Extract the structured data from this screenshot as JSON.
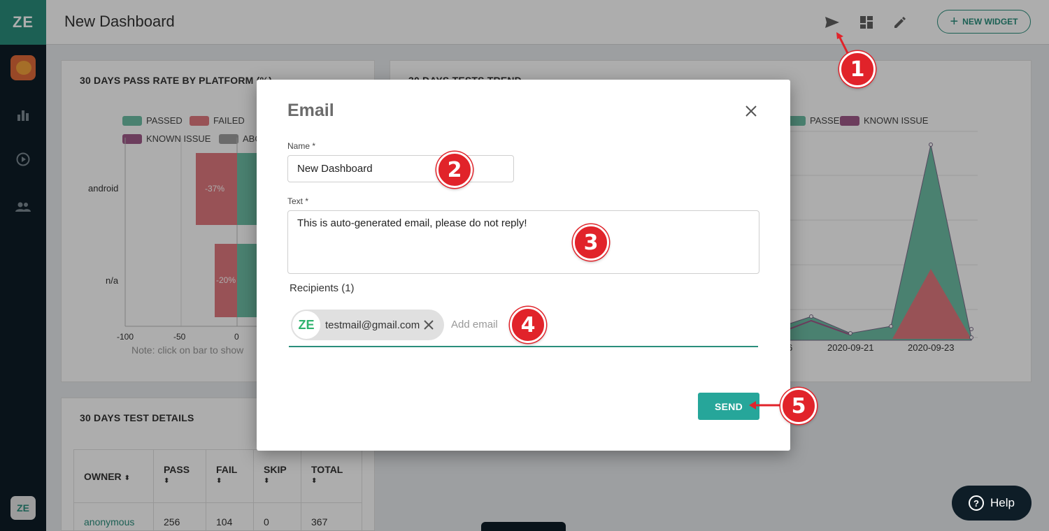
{
  "app": {
    "brand": "ZE",
    "page_title": "New Dashboard",
    "new_widget_label": "NEW WIDGET"
  },
  "sidebar": {
    "items": [
      {
        "icon": "avatar"
      },
      {
        "icon": "bar-chart-icon"
      },
      {
        "icon": "play-circle-icon"
      },
      {
        "icon": "people-icon"
      }
    ],
    "bottom_logo": "ZE"
  },
  "widgets": {
    "pass_rate": {
      "title": "30 DAYS PASS RATE BY PLATFORM (%)",
      "legend": [
        "PASSED",
        "FAILED",
        "KNOWN ISSUE",
        "ABO"
      ],
      "note": "Note: click on bar to show"
    },
    "tests_trend": {
      "title": "30 DAYS TESTS TREND",
      "legend": [
        "PASSED",
        "KNOWN ISSUE"
      ]
    },
    "details": {
      "title": "30 DAYS TEST DETAILS",
      "columns": [
        "OWNER",
        "PASS",
        "FAIL",
        "SKIP",
        "TOTAL"
      ],
      "rows": [
        {
          "owner": "anonymous",
          "pass": "256",
          "fail": "104",
          "skip": "0",
          "total": "367"
        }
      ]
    }
  },
  "chart_data": [
    {
      "type": "bar",
      "title": "30 DAYS PASS RATE BY PLATFORM (%)",
      "categories": [
        "android",
        "n/a"
      ],
      "series": [
        {
          "name": "FAILED",
          "values": [
            -37,
            -20
          ]
        }
      ],
      "xticks": [
        "-100",
        "-50",
        "0"
      ],
      "xlim": [
        -100,
        0
      ]
    },
    {
      "type": "area",
      "title": "30 DAYS TESTS TREND",
      "x_ticks": [
        "6",
        "2020-09-21",
        "2020-09-23"
      ]
    }
  ],
  "modal": {
    "title": "Email",
    "name_label": "Name *",
    "name_value": "New Dashboard",
    "text_label": "Text *",
    "text_value": "This is auto-generated email, please do not reply!",
    "recipients_label": "Recipients (1)",
    "recipient_chip": "testmail@gmail.com",
    "recipient_avatar": "ZE",
    "add_email_placeholder": "Add email",
    "send_label": "SEND"
  },
  "callouts": [
    "1",
    "2",
    "3",
    "4",
    "5"
  ],
  "help": {
    "label": "Help",
    "icon_glyph": "?"
  },
  "colors": {
    "accent": "#2a8e7c",
    "send": "#26a69a",
    "passed": "#6dbfa6",
    "failed": "#e07a7f",
    "known_issue": "#a05a8a",
    "sidebar": "#0e1d27",
    "callout": "#e1232a"
  }
}
